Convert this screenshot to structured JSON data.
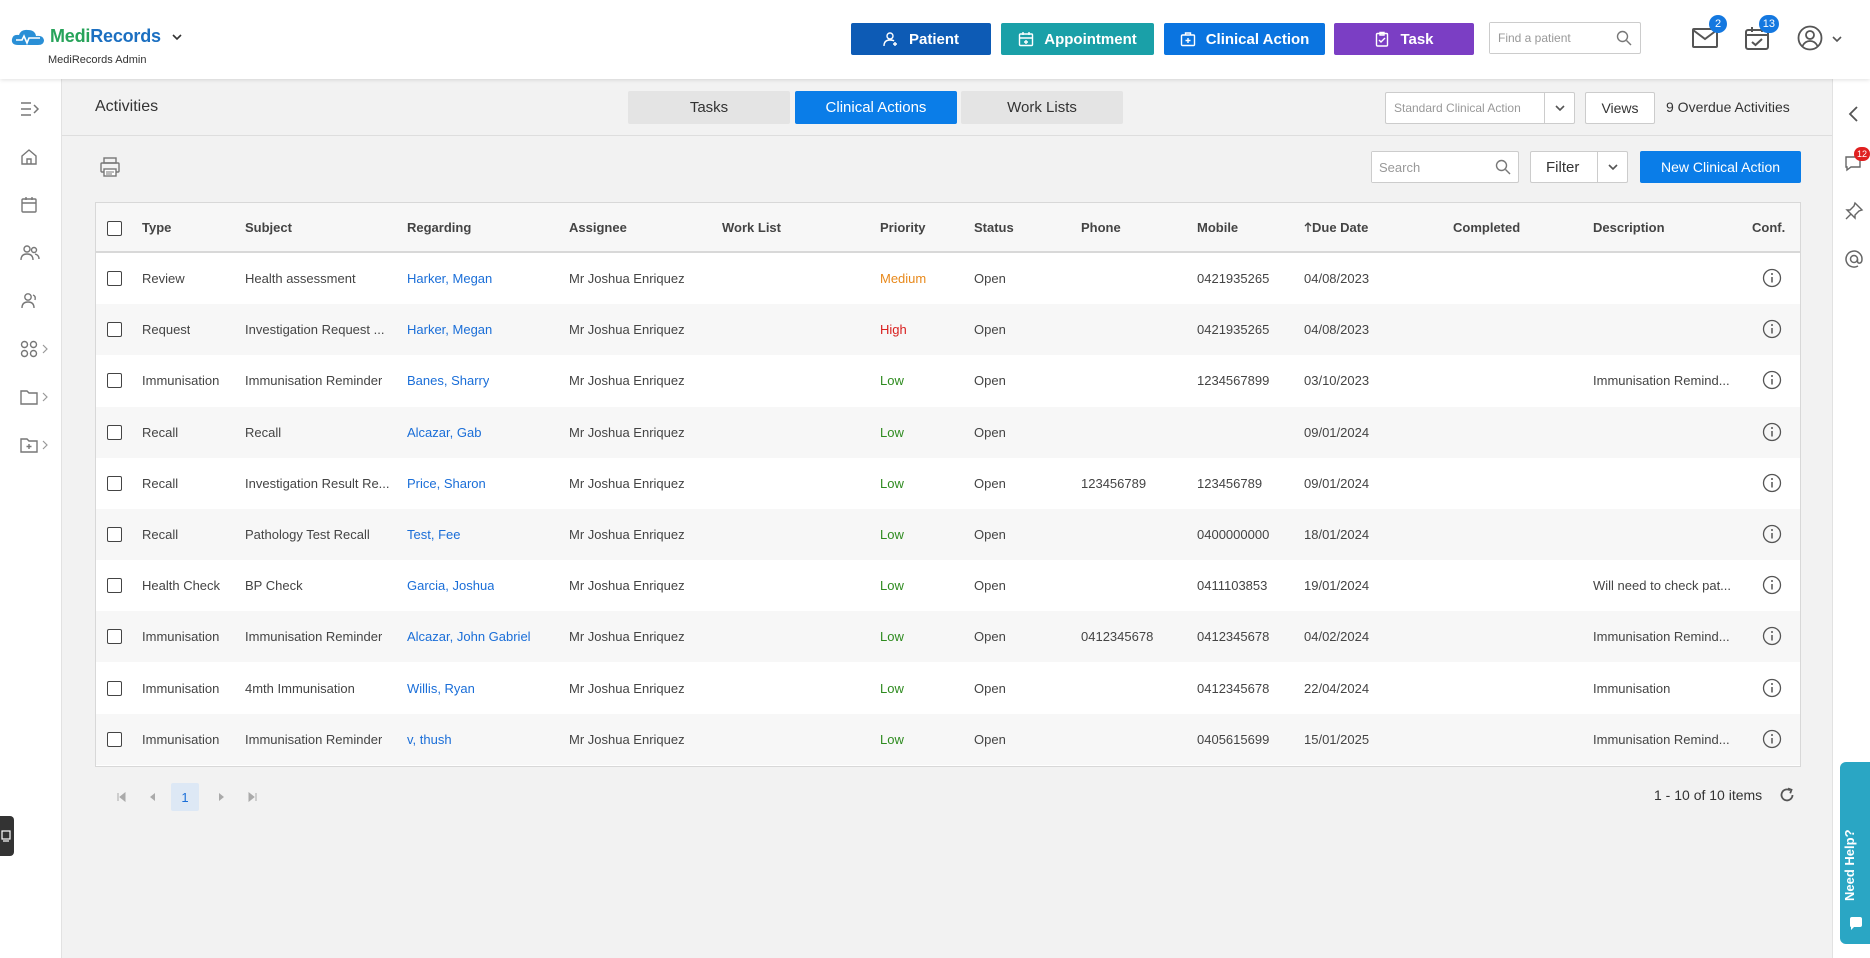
{
  "header": {
    "logo_text": "Medi",
    "logo_text_accent": "Records",
    "org_name": "MediRecords Admin",
    "buttons": {
      "patient": "Patient",
      "appointment": "Appointment",
      "clinical_action": "Clinical Action",
      "task": "Task"
    },
    "find_placeholder": "Find a patient",
    "mail_count": "2",
    "tasks_count": "13"
  },
  "right_sidebar": {
    "chat_count": "12",
    "help_label": "Need Help?"
  },
  "activities": {
    "title": "Activities",
    "tabs": [
      "Tasks",
      "Clinical Actions",
      "Work Lists"
    ],
    "active_tab": "Clinical Actions",
    "standard_select": "Standard Clinical Action",
    "views_label": "Views",
    "overdue_label": "9 Overdue Activities"
  },
  "toolbar": {
    "search_placeholder": "Search",
    "filter_label": "Filter",
    "new_button": "New Clinical Action"
  },
  "table": {
    "columns": [
      "Type",
      "Subject",
      "Regarding",
      "Assignee",
      "Work List",
      "Priority",
      "Status",
      "Phone",
      "Mobile",
      "Due Date",
      "Completed",
      "Description",
      "Conf."
    ],
    "sort_column": "Due Date",
    "rows": [
      {
        "type": "Review",
        "subject": "Health assessment",
        "regarding": "Harker, Megan",
        "assignee": "Mr Joshua Enriquez",
        "worklist": "",
        "priority": "Medium",
        "status": "Open",
        "phone": "",
        "mobile": "0421935265",
        "due": "04/08/2023",
        "completed": "",
        "description": ""
      },
      {
        "type": "Request",
        "subject": "Investigation Request ...",
        "regarding": "Harker, Megan",
        "assignee": "Mr Joshua Enriquez",
        "worklist": "",
        "priority": "High",
        "status": "Open",
        "phone": "",
        "mobile": "0421935265",
        "due": "04/08/2023",
        "completed": "",
        "description": ""
      },
      {
        "type": "Immunisation",
        "subject": "Immunisation Reminder",
        "regarding": "Banes, Sharry",
        "assignee": "Mr Joshua Enriquez",
        "worklist": "",
        "priority": "Low",
        "status": "Open",
        "phone": "",
        "mobile": "1234567899",
        "due": "03/10/2023",
        "completed": "",
        "description": "Immunisation Remind..."
      },
      {
        "type": "Recall",
        "subject": "Recall",
        "regarding": "Alcazar, Gab",
        "assignee": "Mr Joshua Enriquez",
        "worklist": "",
        "priority": "Low",
        "status": "Open",
        "phone": "",
        "mobile": "",
        "due": "09/01/2024",
        "completed": "",
        "description": ""
      },
      {
        "type": "Recall",
        "subject": "Investigation Result Re...",
        "regarding": "Price, Sharon",
        "assignee": "Mr Joshua Enriquez",
        "worklist": "",
        "priority": "Low",
        "status": "Open",
        "phone": "123456789",
        "mobile": "123456789",
        "due": "09/01/2024",
        "completed": "",
        "description": ""
      },
      {
        "type": "Recall",
        "subject": "Pathology Test Recall",
        "regarding": "Test, Fee",
        "assignee": "Mr Joshua Enriquez",
        "worklist": "",
        "priority": "Low",
        "status": "Open",
        "phone": "",
        "mobile": "0400000000",
        "due": "18/01/2024",
        "completed": "",
        "description": ""
      },
      {
        "type": "Health Check",
        "subject": "BP Check",
        "regarding": "Garcia, Joshua",
        "assignee": "Mr Joshua Enriquez",
        "worklist": "",
        "priority": "Low",
        "status": "Open",
        "phone": "",
        "mobile": "0411103853",
        "due": "19/01/2024",
        "completed": "",
        "description": "Will need to check pat..."
      },
      {
        "type": "Immunisation",
        "subject": "Immunisation Reminder",
        "regarding": "Alcazar, John Gabriel",
        "assignee": "Mr Joshua Enriquez",
        "worklist": "",
        "priority": "Low",
        "status": "Open",
        "phone": "0412345678",
        "mobile": "0412345678",
        "due": "04/02/2024",
        "completed": "",
        "description": "Immunisation Remind..."
      },
      {
        "type": "Immunisation",
        "subject": "4mth Immunisation",
        "regarding": "Willis, Ryan",
        "assignee": "Mr Joshua Enriquez",
        "worklist": "",
        "priority": "Low",
        "status": "Open",
        "phone": "",
        "mobile": "0412345678",
        "due": "22/04/2024",
        "completed": "",
        "description": "Immunisation"
      },
      {
        "type": "Immunisation",
        "subject": "Immunisation Reminder",
        "regarding": "v, thush",
        "assignee": "Mr Joshua Enriquez",
        "worklist": "",
        "priority": "Low",
        "status": "Open",
        "phone": "",
        "mobile": "0405615699",
        "due": "15/01/2025",
        "completed": "",
        "description": "Immunisation Remind..."
      }
    ]
  },
  "pager": {
    "current_page": "1",
    "items_label": "1 - 10 of 10 items"
  },
  "colors": {
    "patient_btn": "#0d5bb5",
    "appointment_btn": "#1aa0a8",
    "clinical_btn": "#0a74e0",
    "task_btn": "#7b3ec4",
    "priority_medium": "#e8891b",
    "priority_high": "#d9201f",
    "priority_low": "#2e8b1f",
    "link": "#1a6ed8"
  },
  "icons": [
    "cloud-logo-icon",
    "chevron-down-icon",
    "user-plus-icon",
    "calendar-icon",
    "medical-kit-icon",
    "clipboard-icon",
    "search-icon",
    "mail-icon",
    "calendar-check-icon",
    "user-circle-icon",
    "menu-expand-icon",
    "home-icon",
    "people-icon",
    "apps-icon",
    "folder-icon",
    "print-icon",
    "info-icon",
    "refresh-icon",
    "chevron-left-icon",
    "chat-icon",
    "pin-icon",
    "at-icon"
  ]
}
